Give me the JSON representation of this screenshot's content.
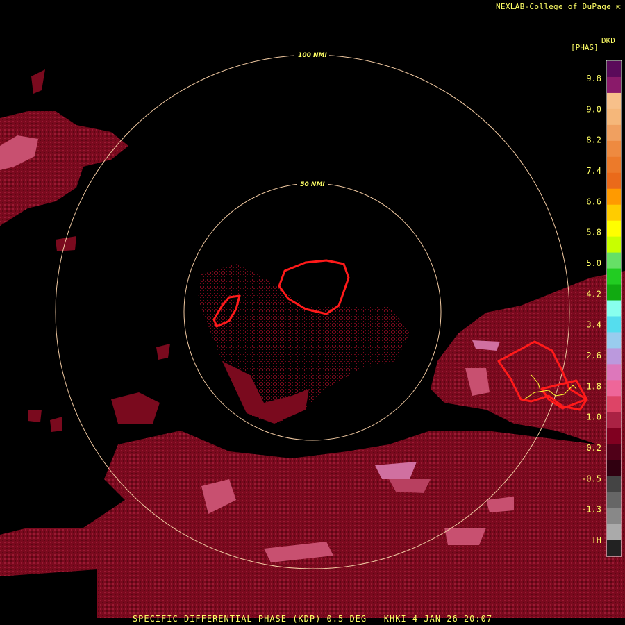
{
  "credit": "NEXLAB-College of DuPage",
  "credit_icon": "arrow-cursor-icon",
  "legend": {
    "product_code": "DKD",
    "unit": "[PHAS]",
    "ticks": [
      "9.8",
      "9.0",
      "8.2",
      "7.4",
      "6.6",
      "5.8",
      "5.0",
      "4.2",
      "3.4",
      "2.6",
      "1.8",
      "1.0",
      "0.2",
      "-0.5",
      "-1.3",
      "TH"
    ],
    "colors": [
      "#5a0a5a",
      "#8a1a6a",
      "#f7c08a",
      "#f5b77a",
      "#f0a060",
      "#ee8a40",
      "#ec7a2a",
      "#ea6a1a",
      "#ff9a00",
      "#ffcc00",
      "#ffff00",
      "#c8ff00",
      "#66e066",
      "#22cc22",
      "#11aa11",
      "#88ffee",
      "#55ddee",
      "#99ccee",
      "#bb99dd",
      "#dd77bb",
      "#ee6699",
      "#dd4466",
      "#aa2244",
      "#800020",
      "#500018",
      "#300010",
      "#444444",
      "#666666",
      "#888888",
      "#aaaaaa",
      "#222222"
    ]
  },
  "range_rings": [
    "50 NMI",
    "100 NMI"
  ],
  "caption": "SPECIFIC DIFFERENTIAL PHASE (KDP) 0.5 DEG - KHKI 4 JAN 26 20:07"
}
